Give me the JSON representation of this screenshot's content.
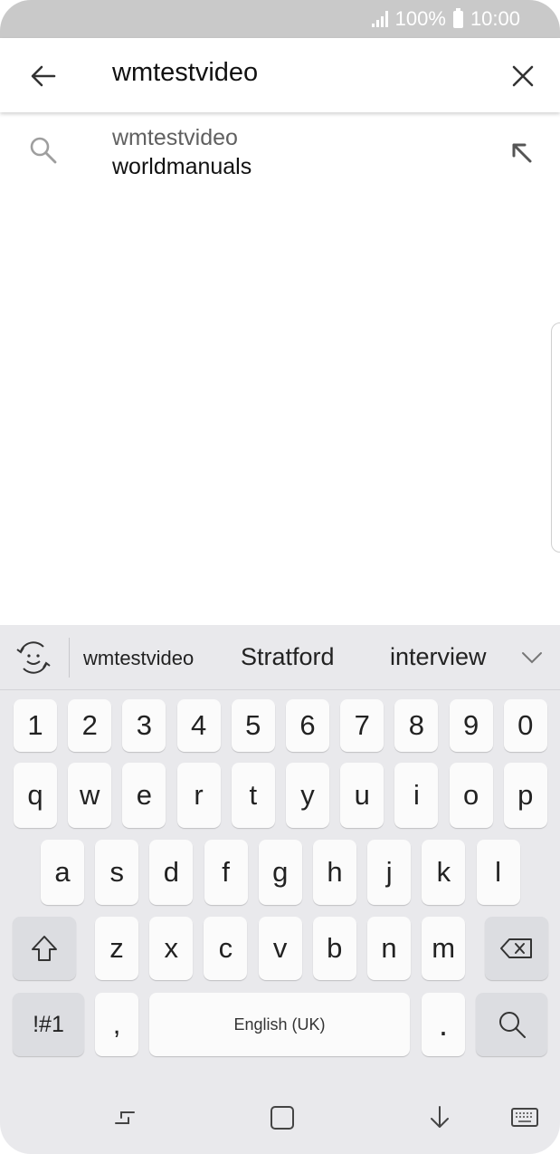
{
  "status_bar": {
    "battery": "100%",
    "time": "10:00"
  },
  "search": {
    "query": "wmtestvideo",
    "back_icon": "back-arrow-icon",
    "clear_icon": "close-icon"
  },
  "suggestions": [
    {
      "line1": "wmtestvideo",
      "line2": "worldmanuals",
      "icon": "search-icon",
      "action_icon": "fill-query-arrow-icon"
    }
  ],
  "keyboard": {
    "predictions": [
      "wmtestvideo",
      "Stratford",
      "interview"
    ],
    "number_row": [
      "1",
      "2",
      "3",
      "4",
      "5",
      "6",
      "7",
      "8",
      "9",
      "0"
    ],
    "row1": [
      "q",
      "w",
      "e",
      "r",
      "t",
      "y",
      "u",
      "i",
      "o",
      "p"
    ],
    "row2": [
      "a",
      "s",
      "d",
      "f",
      "g",
      "h",
      "j",
      "k",
      "l"
    ],
    "row3": [
      "z",
      "x",
      "c",
      "v",
      "b",
      "n",
      "m"
    ],
    "symbols_label": "!#1",
    "comma": ",",
    "space_label": "English (UK)",
    "period": "."
  },
  "colors": {
    "status_bar": "#c9c9c9",
    "keyboard_bg": "#e9e9ec",
    "key_bg": "#fbfbfb",
    "key_dark_bg": "#dcdde1"
  }
}
